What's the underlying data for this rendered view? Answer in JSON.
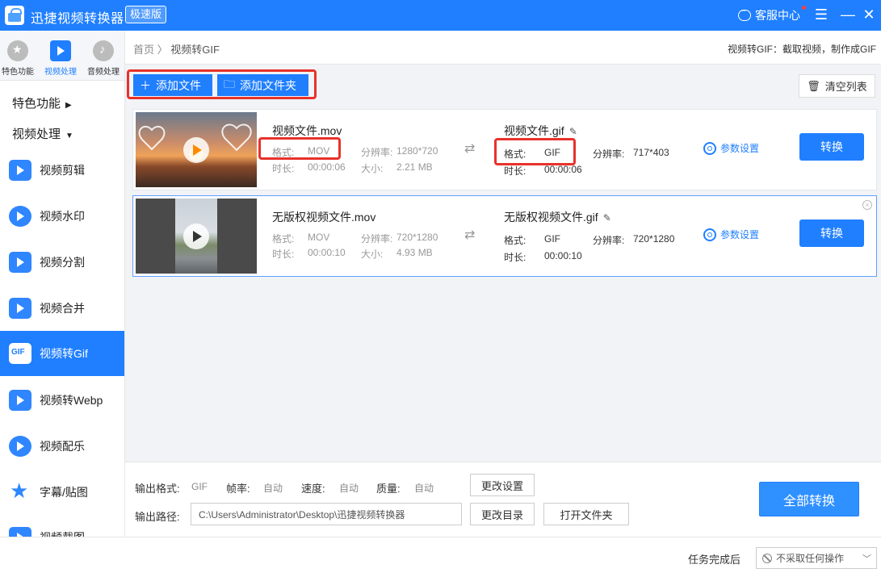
{
  "app": {
    "title": "迅捷视频转换器",
    "badge": "极速版",
    "service": "客服中心"
  },
  "window_controls": {
    "menu": "☰",
    "minimize": "—",
    "close": "✕"
  },
  "top_tabs": [
    {
      "label": "特色功能",
      "icon": "star-icon"
    },
    {
      "label": "视频处理",
      "icon": "film-icon"
    },
    {
      "label": "音频处理",
      "icon": "audio-icon"
    }
  ],
  "sidebar": {
    "sections": {
      "featured": "特色功能",
      "video": "视频处理"
    },
    "items": [
      {
        "label": "视频剪辑",
        "icon": "video-cut-icon"
      },
      {
        "label": "视频水印",
        "icon": "video-watermark-icon"
      },
      {
        "label": "视频分割",
        "icon": "video-split-icon"
      },
      {
        "label": "视频合并",
        "icon": "video-merge-icon"
      },
      {
        "label": "视频转Gif",
        "icon": "gif-icon"
      },
      {
        "label": "视频转Webp",
        "icon": "webp-icon"
      },
      {
        "label": "视频配乐",
        "icon": "music-icon"
      },
      {
        "label": "字幕/贴图",
        "icon": "subtitle-sticker-icon"
      },
      {
        "label": "视频截图",
        "icon": "screenshot-icon"
      }
    ]
  },
  "breadcrumb": {
    "home": "首页",
    "sep": "〉",
    "current": "视频转GIF"
  },
  "header_desc": "视频转GIF：截取视频，制作成GIF",
  "toolbar": {
    "add_file": "添加文件",
    "add_folder": "添加文件夹",
    "clear": "清空列表"
  },
  "labels": {
    "format": "格式:",
    "resolution": "分辨率:",
    "duration": "时长:",
    "size": "大小:",
    "params": "参数设置",
    "convert": "转换"
  },
  "files": [
    {
      "src_name": "视频文件.mov",
      "src_format": "MOV",
      "src_resolution": "1280*720",
      "src_duration": "00:00:06",
      "src_size": "2.21 MB",
      "out_name": "视频文件.gif",
      "out_format": "GIF",
      "out_resolution": "717*403",
      "out_duration": "00:00:06"
    },
    {
      "src_name": "无版权视频文件.mov",
      "src_format": "MOV",
      "src_resolution": "720*1280",
      "src_duration": "00:00:10",
      "src_size": "4.93 MB",
      "out_name": "无版权视频文件.gif",
      "out_format": "GIF",
      "out_resolution": "720*1280",
      "out_duration": "00:00:10"
    }
  ],
  "output": {
    "format_label": "输出格式:",
    "format": "GIF",
    "fps_label": "帧率:",
    "fps": "自动",
    "speed_label": "速度:",
    "speed": "自动",
    "quality_label": "质量:",
    "quality": "自动",
    "change_settings": "更改设置",
    "path_label": "输出路径:",
    "path": "C:\\Users\\Administrator\\Desktop\\迅捷视频转换器",
    "change_dir": "更改目录",
    "open_folder": "打开文件夹",
    "convert_all": "全部转换"
  },
  "status": {
    "after_label": "任务完成后",
    "after_value": "不采取任何操作"
  },
  "colors": {
    "brand": "#1f7fff",
    "highlight": "#e8322b"
  }
}
